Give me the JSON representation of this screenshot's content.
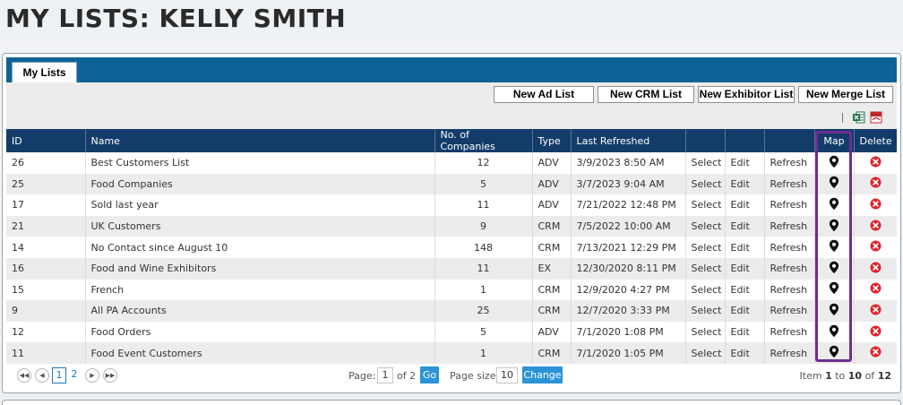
{
  "page": {
    "title": "MY LISTS: KELLY SMITH"
  },
  "tabs": [
    {
      "label": "My Lists"
    }
  ],
  "toolbar": {
    "new_ad": "New Ad List",
    "new_crm": "New CRM List",
    "new_exhibitor": "New Exhibitor List",
    "new_merge": "New Merge List"
  },
  "columns": {
    "id": "ID",
    "name": "Name",
    "companies": "No. of Companies",
    "type": "Type",
    "refreshed": "Last Refreshed",
    "select": "",
    "edit": "",
    "refresh": "",
    "map": "Map",
    "delete": "Delete"
  },
  "rows": [
    {
      "id": "26",
      "name": "Best Customers List",
      "companies": "12",
      "type": "ADV",
      "refreshed": "3/9/2023 8:50 AM",
      "select": "Select",
      "edit": "Edit",
      "refresh": "Refresh"
    },
    {
      "id": "25",
      "name": "Food Companies",
      "companies": "5",
      "type": "ADV",
      "refreshed": "3/7/2023 9:04 AM",
      "select": "Select",
      "edit": "Edit",
      "refresh": "Refresh"
    },
    {
      "id": "17",
      "name": "Sold last year",
      "companies": "11",
      "type": "ADV",
      "refreshed": "7/21/2022 12:48 PM",
      "select": "Select",
      "edit": "Edit",
      "refresh": "Refresh"
    },
    {
      "id": "21",
      "name": "UK Customers",
      "companies": "9",
      "type": "CRM",
      "refreshed": "7/5/2022 10:00 AM",
      "select": "Select",
      "edit": "Edit",
      "refresh": "Refresh"
    },
    {
      "id": "14",
      "name": "No Contact since August 10",
      "companies": "148",
      "type": "CRM",
      "refreshed": "7/13/2021 12:29 PM",
      "select": "Select",
      "edit": "Edit",
      "refresh": "Refresh"
    },
    {
      "id": "16",
      "name": "Food and Wine Exhibitors",
      "companies": "11",
      "type": "EX",
      "refreshed": "12/30/2020 8:11 PM",
      "select": "Select",
      "edit": "Edit",
      "refresh": "Refresh"
    },
    {
      "id": "15",
      "name": "French",
      "companies": "1",
      "type": "CRM",
      "refreshed": "12/9/2020 4:27 PM",
      "select": "Select",
      "edit": "Edit",
      "refresh": "Refresh"
    },
    {
      "id": "9",
      "name": "All PA Accounts",
      "companies": "25",
      "type": "CRM",
      "refreshed": "12/7/2020 3:33 PM",
      "select": "Select",
      "edit": "Edit",
      "refresh": "Refresh"
    },
    {
      "id": "12",
      "name": "Food Orders",
      "companies": "5",
      "type": "ADV",
      "refreshed": "7/1/2020 1:08 PM",
      "select": "Select",
      "edit": "Edit",
      "refresh": "Refresh"
    },
    {
      "id": "11",
      "name": "Food Event Customers",
      "companies": "1",
      "type": "CRM",
      "refreshed": "7/1/2020 1:05 PM",
      "select": "Select",
      "edit": "Edit",
      "refresh": "Refresh"
    }
  ],
  "pager": {
    "pages": [
      "1",
      "2"
    ],
    "current_page": "1",
    "page_label": "Page:",
    "page_value": "1",
    "of_label": "of 2",
    "go_label": "Go",
    "page_size_label": "Page size:",
    "page_size_value": "10",
    "change_label": "Change",
    "item_label": "Item",
    "item_from": "1",
    "to_label": "to",
    "item_to": "10",
    "of_total_label": "of",
    "item_total": "12"
  },
  "icons": {
    "export": [
      "excel-icon",
      "pdf-icon"
    ],
    "map": "map-pin-icon",
    "delete": "delete-icon"
  },
  "colors": {
    "header_bg": "#133c6a",
    "tab_strip": "#0c6496",
    "link": "#1a7bc1",
    "delete_red": "#e0242b",
    "highlight": "#6f2c91"
  }
}
